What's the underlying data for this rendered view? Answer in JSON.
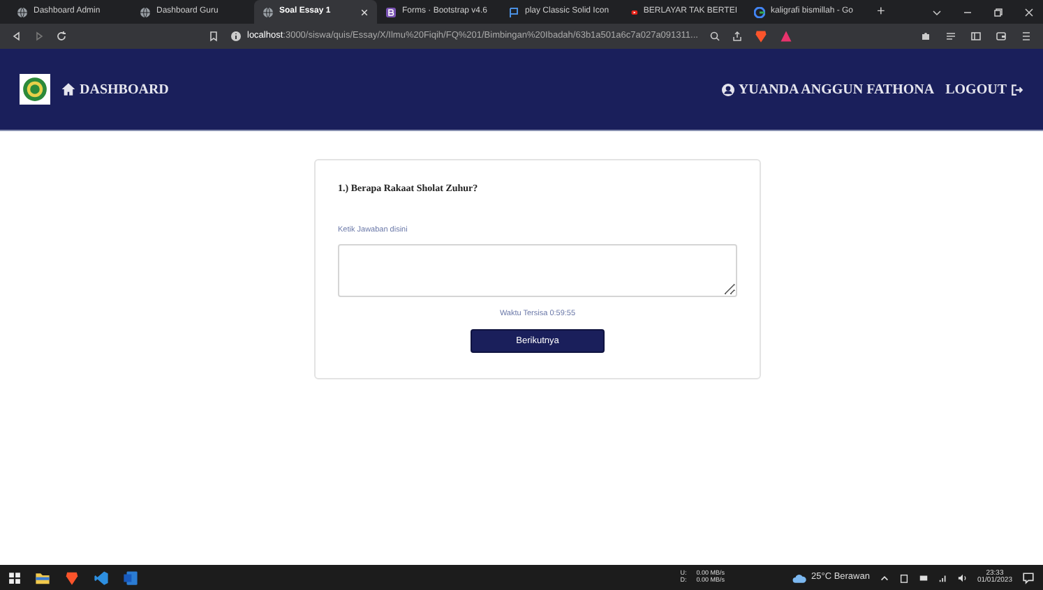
{
  "browser": {
    "tabs": [
      {
        "label": "Dashboard Admin",
        "kind": "globe",
        "selected": false
      },
      {
        "label": "Dashboard Guru",
        "kind": "globe",
        "selected": false
      },
      {
        "label": "Soal Essay 1",
        "kind": "globe",
        "selected": true
      },
      {
        "label": "Forms · Bootstrap v4.6",
        "kind": "bootstrap",
        "selected": false
      },
      {
        "label": "play Classic Solid Icon",
        "kind": "flag",
        "selected": false
      },
      {
        "label": "BERLAYAR TAK BERTEI",
        "kind": "video",
        "selected": false
      },
      {
        "label": "kaligrafi bismillah - Go",
        "kind": "google",
        "selected": false
      }
    ],
    "new_tab": "+",
    "url_host": "localhost",
    "url_rest": ":3000/siswa/quis/Essay/X/Ilmu%20Fiqih/FQ%201/Bimbingan%20Ibadah/63b1a501a6c7a027a091311..."
  },
  "navbar": {
    "brand": "DASHBOARD",
    "user": "YUANDA ANGGUN FATHONA",
    "logout": "LOGOUT"
  },
  "quiz": {
    "question": "1.) Berapa Rakaat Sholat Zuhur?",
    "answer_label": "Ketik Jawaban disini",
    "timer": "Waktu Tersisa 0:59:55",
    "next_button": "Berikutnya"
  },
  "taskbar": {
    "upload": "U:",
    "download": "D:",
    "upload_speed": "0.00 MB/s",
    "download_speed": "0.00 MB/s",
    "weather": "25°C  Berawan",
    "time": "23:33",
    "date": "01/01/2023"
  }
}
